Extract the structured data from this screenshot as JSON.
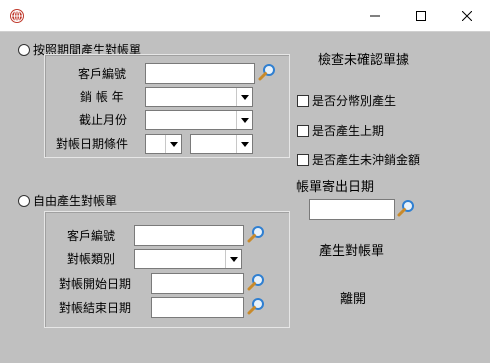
{
  "window": {
    "icon": "globe-icon",
    "controls": [
      "minimize-icon",
      "maximize-icon",
      "close-icon"
    ]
  },
  "section_period": {
    "radio_label": "按照期間產生對帳單",
    "customer_label": "客戶編號",
    "customer_value": "",
    "sales_year_label": "銷 帳 年",
    "sales_year_value": "",
    "cutoff_month_label": "截止月份",
    "cutoff_month_value": "",
    "date_cond_label": "對帳日期條件",
    "date_cond_op_value": "",
    "date_cond_value": ""
  },
  "section_free": {
    "radio_label": "自由產生對帳單",
    "customer_label": "客戶編號",
    "customer_value": "",
    "type_label": "對帳類別",
    "type_value": "",
    "start_date_label": "對帳開始日期",
    "start_date_value": "",
    "end_date_label": "對帳結束日期",
    "end_date_value": ""
  },
  "right_panel": {
    "check_unconfirmed_label": "檢查未確認單據",
    "options": [
      {
        "label": "是否分幣別產生",
        "checked": false
      },
      {
        "label": "是否產生上期",
        "checked": false
      },
      {
        "label": "是否產生未沖銷金額",
        "checked": false
      }
    ],
    "send_date_label": "帳單寄出日期",
    "send_date_value": "",
    "generate_label": "產生對帳單",
    "leave_label": "離開"
  },
  "colors": {
    "background": "#c0c0c0",
    "icon_red": "#c0392b",
    "magnifier_blue": "#2f7fd1"
  }
}
